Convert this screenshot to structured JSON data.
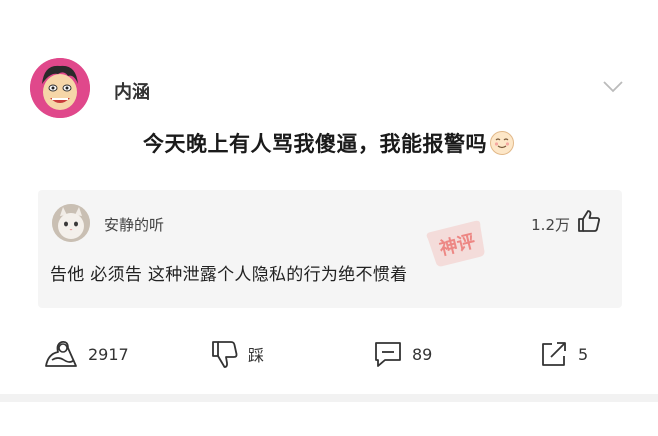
{
  "post": {
    "author": "内涵",
    "title": "今天晚上有人骂我傻逼，我能报警吗"
  },
  "comment": {
    "commenter": "安静的听",
    "likes": "1.2万",
    "text": "告他  必须告  这种泄露个人隐私的行为绝不惯着",
    "stamp_text": "神评"
  },
  "actions": {
    "share_count": "2917",
    "dislike_label": "踩",
    "comment_count": "89",
    "forward_count": "5"
  },
  "colors": {
    "avatar_bg": "#e0488b",
    "stamp": "#e8433f",
    "card_bg": "#f5f5f5"
  },
  "icons": [
    "chevron-down-icon",
    "thumbs-up-icon",
    "share-icon",
    "thumbs-down-icon",
    "comment-icon",
    "forward-icon",
    "smile-emoji-icon"
  ]
}
